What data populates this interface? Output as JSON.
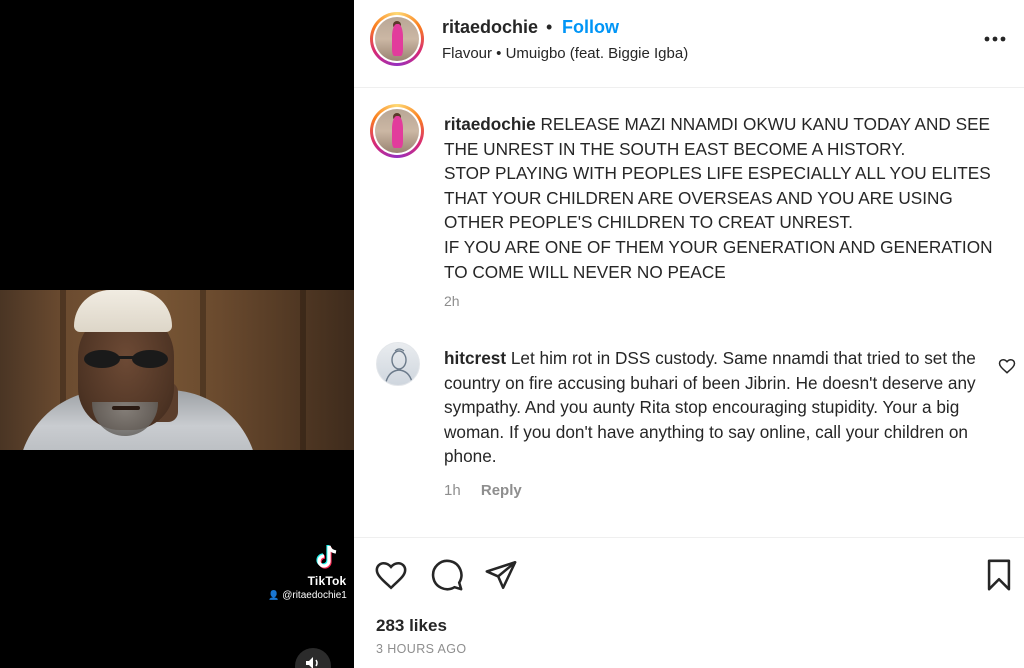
{
  "header": {
    "username": "ritaedochie",
    "separator": "•",
    "follow_label": "Follow",
    "audio": "Flavour • Umuigbo (feat. Biggie Igba)",
    "more_icon": "more-options-icon"
  },
  "caption": {
    "username": "ritaedochie",
    "text": "RELEASE MAZI NNAMDI OKWU KANU TODAY AND SEE THE UNREST IN THE SOUTH EAST BECOME A HISTORY.",
    "lines": [
      "STOP PLAYING WITH PEOPLES LIFE ESPECIALLY ALL YOU ELITES THAT YOUR CHILDREN ARE OVERSEAS AND YOU ARE USING OTHER PEOPLE'S CHILDREN TO CREAT UNREST.",
      "IF YOU ARE ONE OF THEM YOUR GENERATION AND GENERATION TO COME WILL NEVER NO PEACE"
    ],
    "time": "2h"
  },
  "comment": {
    "username": "hitcrest",
    "text": "Let him rot in DSS custody. Same nnamdi that tried to set the country on fire accusing buhari of been Jibrin. He doesn't deserve any sympathy. And you aunty Rita stop encouraging stupidity. Your a big woman. If you don't have anything to say online, call your children on phone.",
    "time": "1h",
    "reply_label": "Reply",
    "like_icon": "heart-outline-icon"
  },
  "video": {
    "watermark": "TikTok",
    "handle": "@ritaedochie1",
    "volume_icon": "speaker-icon"
  },
  "actions": {
    "likes": "283 likes",
    "posted": "3 HOURS AGO",
    "icons": [
      "heart-icon",
      "comment-bubble-icon",
      "paper-plane-icon",
      "bookmark-icon"
    ]
  },
  "colors": {
    "follow": "#0095f6",
    "text": "#262626",
    "muted": "#8e8e8e",
    "divider": "#efefef"
  }
}
